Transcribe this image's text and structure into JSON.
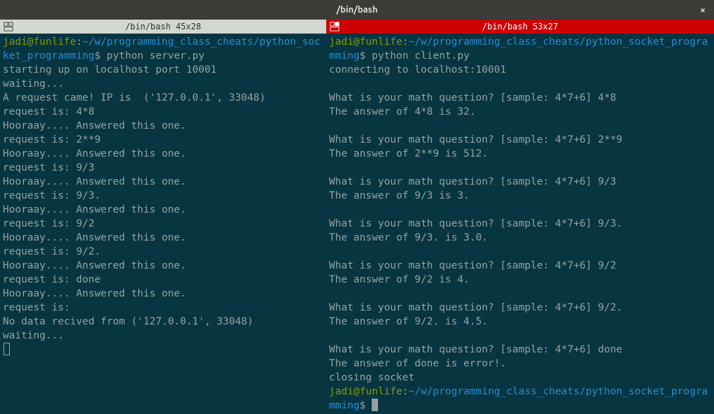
{
  "window": {
    "title": "/bin/bash"
  },
  "left_pane": {
    "header_title": "/bin/bash 45x28",
    "prompt_user": "jadi@funlife",
    "prompt_path": "~/w/programming_class_cheats/python_socket_programming",
    "command": "python server.py",
    "lines": [
      "starting up on localhost port 10001",
      "waiting...",
      "A request came! IP is  ('127.0.0.1', 33048)",
      "request is: 4*8",
      "Hooraay.... Answered this one.",
      "request is: 2**9",
      "Hooraay.... Answered this one.",
      "request is: 9/3",
      "Hooraay.... Answered this one.",
      "request is: 9/3.",
      "Hooraay.... Answered this one.",
      "request is: 9/2",
      "Hooraay.... Answered this one.",
      "request is: 9/2.",
      "Hooraay.... Answered this one.",
      "request is: done",
      "Hooraay.... Answered this one.",
      "request is:",
      "No data recived from ('127.0.0.1', 33048)",
      "waiting..."
    ]
  },
  "right_pane": {
    "header_title": "/bin/bash 53x27",
    "prompt_user": "jadi@funlife",
    "prompt_path": "~/w/programming_class_cheats/python_socket_programming",
    "command": "python client.py",
    "lines": [
      "connecting to localhost:10001",
      "",
      "What is your math question? [sample: 4*7+6] 4*8",
      "The answer of 4*8 is 32.",
      "",
      "What is your math question? [sample: 4*7+6] 2**9",
      "The answer of 2**9 is 512.",
      "",
      "What is your math question? [sample: 4*7+6] 9/3",
      "The answer of 9/3 is 3.",
      "",
      "What is your math question? [sample: 4*7+6] 9/3.",
      "The answer of 9/3. is 3.0.",
      "",
      "What is your math question? [sample: 4*7+6] 9/2",
      "The answer of 9/2 is 4.",
      "",
      "What is your math question? [sample: 4*7+6] 9/2.",
      "The answer of 9/2. is 4.5.",
      "",
      "What is your math question? [sample: 4*7+6] done",
      "The answer of done is error!.",
      "closing socket"
    ],
    "prompt2_user": "jadi@funlife",
    "prompt2_path": "~/w/programming_class_cheats/python_socket_programming"
  }
}
